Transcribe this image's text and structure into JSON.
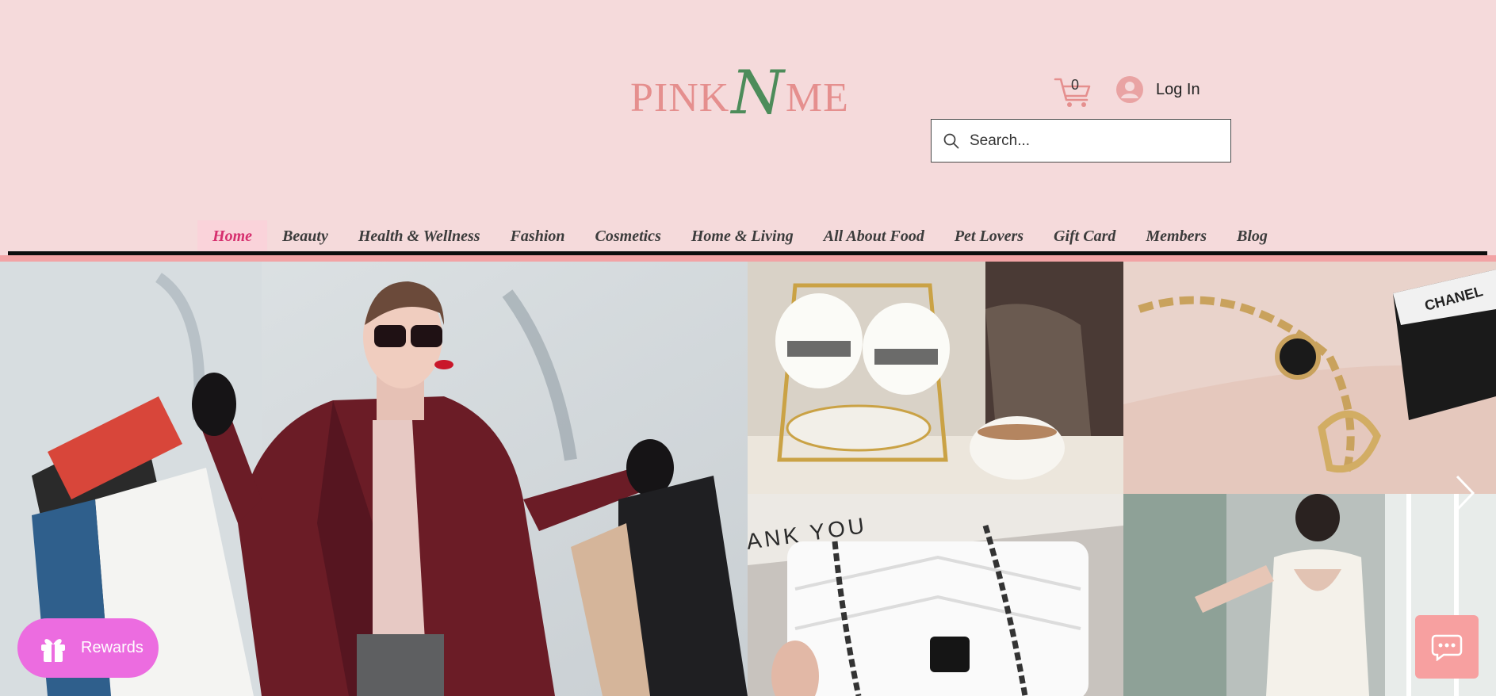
{
  "brand": {
    "part1": "PINK",
    "part2": "N",
    "part3": "ME"
  },
  "cart": {
    "count": "0"
  },
  "account": {
    "login_label": "Log In"
  },
  "search": {
    "placeholder": "Search..."
  },
  "nav": {
    "items": [
      {
        "label": "Home"
      },
      {
        "label": "Beauty"
      },
      {
        "label": "Health & Wellness"
      },
      {
        "label": "Fashion"
      },
      {
        "label": "Cosmetics"
      },
      {
        "label": "Home & Living"
      },
      {
        "label": "All About Food"
      },
      {
        "label": "Pet Lovers"
      },
      {
        "label": "Gift Card"
      },
      {
        "label": "Members"
      },
      {
        "label": "Blog"
      }
    ],
    "active": "Home"
  },
  "widgets": {
    "rewards_label": "Rewards"
  },
  "gallery": {
    "box_brand": "CHANEL",
    "box_text": "ANK YOU"
  },
  "colors": {
    "header_bg": "#f5dadb",
    "logo_pink": "#e58f8e",
    "logo_green": "#4d8c5a",
    "nav_active": "#d62f6e",
    "rewards": "#ec6ce0",
    "chat": "#f7a0a0"
  }
}
